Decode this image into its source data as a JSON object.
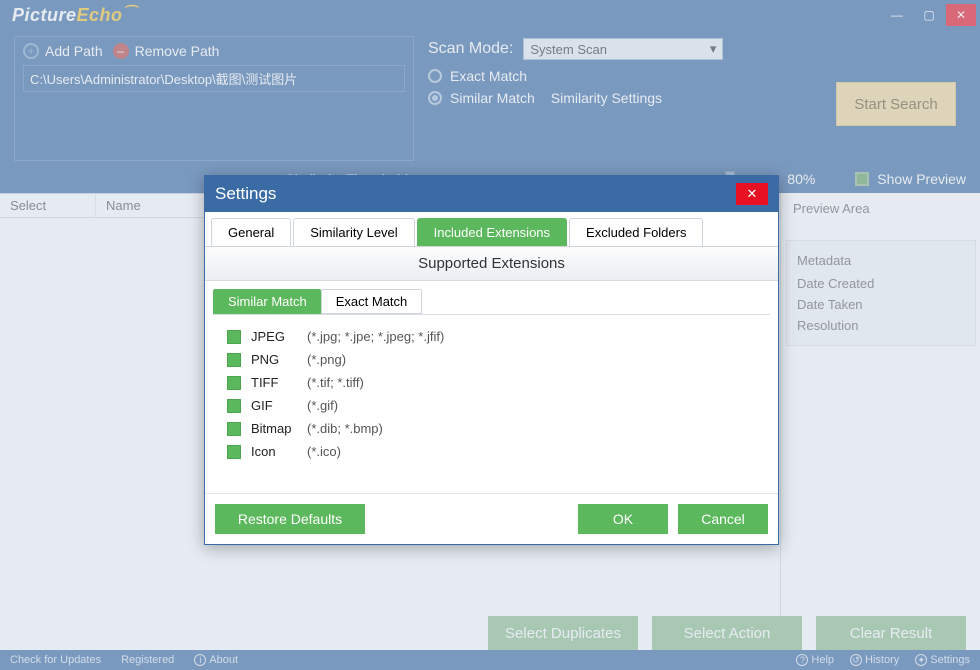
{
  "app": {
    "logo_part1": "Picture",
    "logo_part2": "Echo"
  },
  "titlebar": {
    "min": "—",
    "max": "▢",
    "close": "✕"
  },
  "toolbar": {
    "add_path": "Add Path",
    "remove_path": "Remove Path",
    "path_value": "C:\\Users\\Administrator\\Desktop\\截图\\测试图片"
  },
  "scan": {
    "mode_label": "Scan Mode:",
    "mode_value": "System Scan",
    "exact": "Exact Match",
    "similar": "Similar Match",
    "sim_settings": "Similarity Settings",
    "threshold_label": "Similarity Threshold",
    "threshold_pct": "80%",
    "start": "Start Search",
    "show_preview": "Show Preview"
  },
  "columns": {
    "select": "Select",
    "name": "Name"
  },
  "preview": {
    "title": "Preview Area"
  },
  "metadata": {
    "title": "Metadata",
    "date_created": "Date Created",
    "date_taken": "Date Taken",
    "resolution": "Resolution"
  },
  "actions": {
    "select_dup": "Select Duplicates",
    "select_act": "Select Action",
    "clear": "Clear Result"
  },
  "status": {
    "check": "Check for Updates",
    "registered": "Registered",
    "about": "About",
    "help": "Help",
    "history": "History",
    "settings": "Settings"
  },
  "modal": {
    "title": "Settings",
    "tabs": {
      "general": "General",
      "simlevel": "Similarity Level",
      "incext": "Included Extensions",
      "exfold": "Excluded Folders"
    },
    "section": "Supported Extensions",
    "subtabs": {
      "similar": "Similar Match",
      "exact": "Exact Match"
    },
    "ext": [
      {
        "name": "JPEG",
        "pat": "(*.jpg; *.jpe; *.jpeg; *.jfif)"
      },
      {
        "name": "PNG",
        "pat": "(*.png)"
      },
      {
        "name": "TIFF",
        "pat": "(*.tif; *.tiff)"
      },
      {
        "name": "GIF",
        "pat": "(*.gif)"
      },
      {
        "name": "Bitmap",
        "pat": "(*.dib; *.bmp)"
      },
      {
        "name": "Icon",
        "pat": "(*.ico)"
      }
    ],
    "restore": "Restore Defaults",
    "ok": "OK",
    "cancel": "Cancel"
  }
}
